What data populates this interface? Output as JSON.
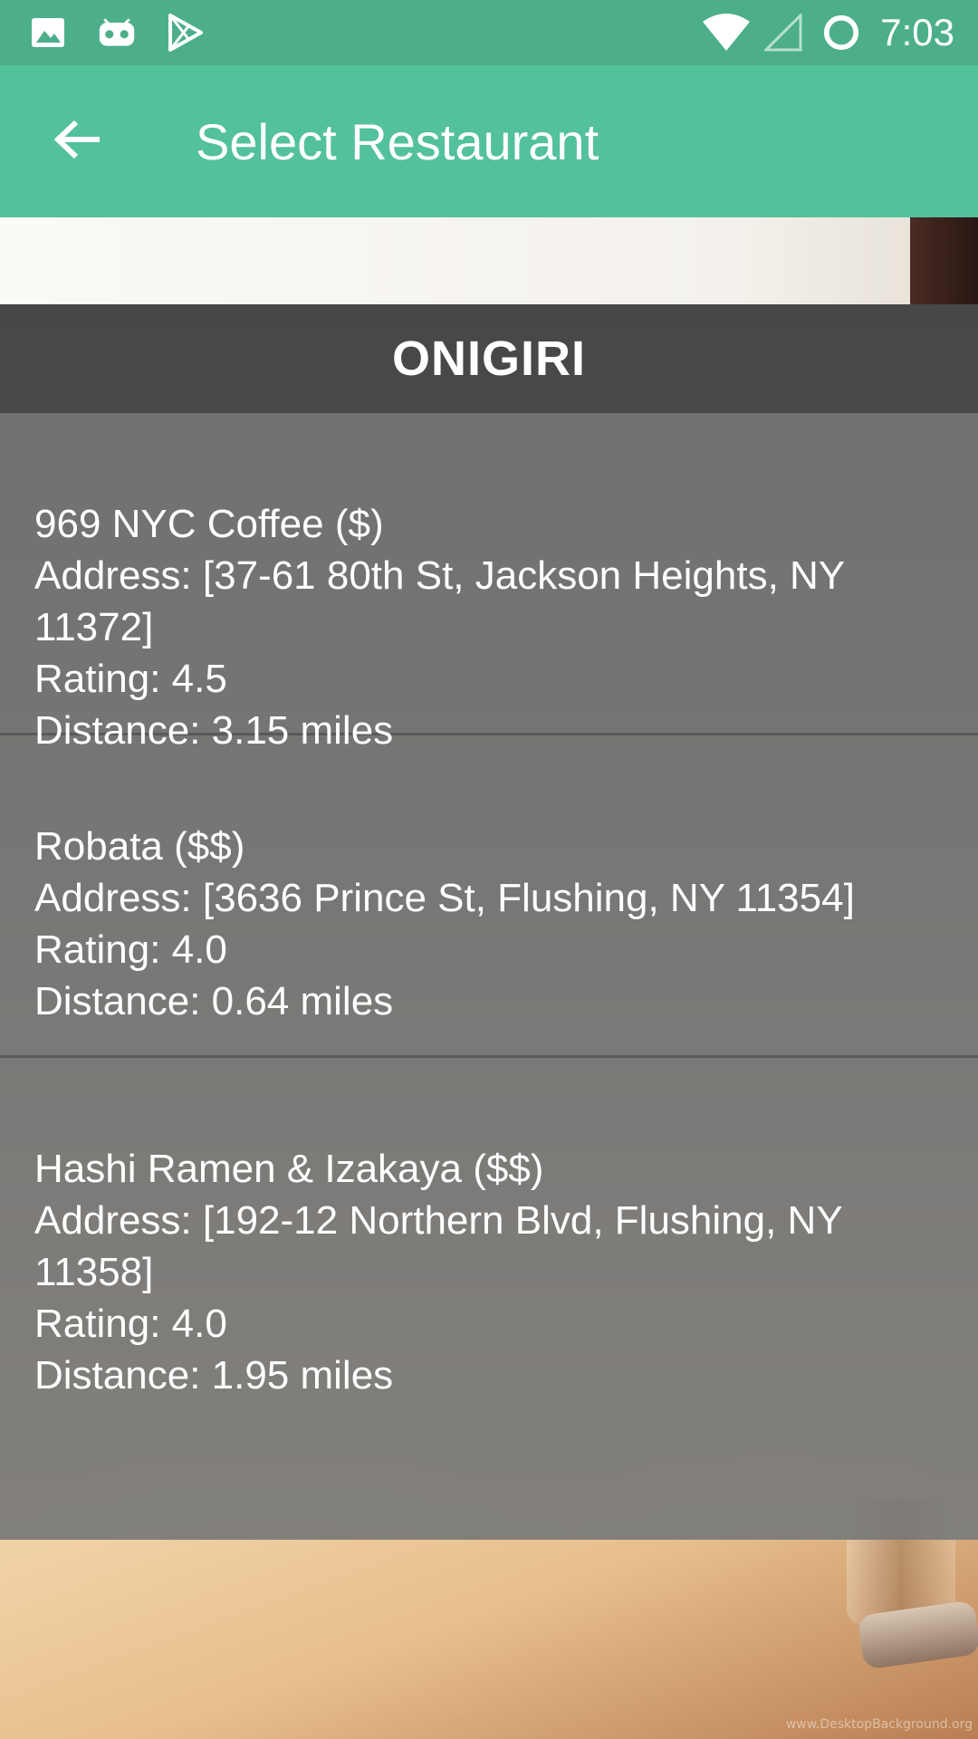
{
  "status_bar": {
    "time": "7:03",
    "left_icons": [
      "image-icon",
      "voicemail-icon",
      "play-store-icon"
    ],
    "right_icons": [
      "wifi-icon",
      "signal-icon",
      "sync-icon"
    ],
    "background_color": "#4caf8a"
  },
  "app_bar": {
    "title": "Select Restaurant",
    "back_icon": "arrow-left-icon",
    "background_color": "#53c19a"
  },
  "category": {
    "title": "ONIGIRI"
  },
  "restaurants": [
    {
      "name_line": "969 NYC Coffee ($)",
      "address_label": "Address: ",
      "address": "[37-61 80th St, Jackson Heights, NY 11372]",
      "rating_label": "Rating: ",
      "rating": "4.5",
      "distance_label": "Distance: ",
      "distance": "3.15 miles"
    },
    {
      "name_line": "Robata ($$)",
      "address_label": "Address: ",
      "address": "[3636 Prince St, Flushing, NY 11354]",
      "rating_label": "Rating: ",
      "rating": "4.0",
      "distance_label": "Distance: ",
      "distance": "0.64 miles"
    },
    {
      "name_line": "Hashi Ramen & Izakaya ($$)",
      "address_label": "Address: ",
      "address": "[192-12 Northern Blvd, Flushing, NY 11358]",
      "rating_label": "Rating: ",
      "rating": "4.0",
      "distance_label": "Distance: ",
      "distance": "1.95 miles"
    }
  ],
  "watermark": "www.DesktopBackground.org"
}
